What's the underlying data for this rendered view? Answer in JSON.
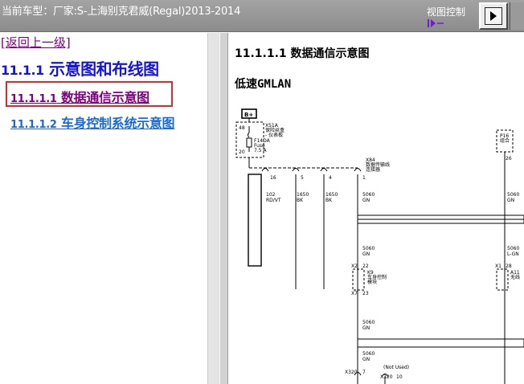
{
  "header": {
    "vehicle_text": "当前车型：厂家:S-上海别克君威(Regal)2013-2014",
    "view_control_label": "视图控制",
    "scroll_icon": "scroll-arrows-icon",
    "view_button_icon": "arrow-right-icon"
  },
  "nav": {
    "back_label": "[返回上一级]",
    "section_number": "11.1.1",
    "section_title": "示意图和布线图",
    "items": [
      {
        "number": "11.1.1.1",
        "label": "数据通信示意图",
        "state": "visited-current"
      },
      {
        "number": "11.1.1.2",
        "label": "车身控制系统示意图",
        "state": "link"
      }
    ],
    "highlight_color": "#e02a2a",
    "link_color": "#1a6ad6",
    "visited_color": "#800080",
    "heading_color": "#1515d6"
  },
  "content": {
    "title": "11.1.1.1 数据通信示意图",
    "subtitle": "低速GMLAN",
    "diagram": {
      "battery": "B+",
      "fuse_block_id": "X51A",
      "fuse_block_name_1": "保险丝盒",
      "fuse_block_name_2": "- 仪表板",
      "fuse_pin_top": "48",
      "fuse_pin_bottom": "20",
      "fuse_name": "F14DA",
      "fuse_word": "Fuse",
      "fuse_rating": "7.5 A",
      "right_connector_id": "P16",
      "right_connector_name": "组合",
      "right_connector_pin": "26",
      "dlc_id": "X84",
      "dlc_name_1": "数据传输线",
      "dlc_name_2": "连接器",
      "dlc_pins": [
        "16",
        "5",
        "4",
        "1"
      ],
      "wires": [
        {
          "circuit": "102",
          "color": "RD/VT"
        },
        {
          "circuit": "1650",
          "color": "BK"
        },
        {
          "circuit": "1650",
          "color": "BK"
        },
        {
          "circuit": "5060",
          "color": "GN"
        }
      ],
      "right_wire_circuit": "5060",
      "right_wire_color": "GN",
      "mid_wire_circuit": "5060",
      "mid_wire_color": "GN",
      "right_mid_circuit": "5060",
      "right_mid_color": "L-GN",
      "bcm_pin_top_conn": "X2",
      "bcm_pin_top": "22",
      "bcm_pin_bottom_conn": "X7",
      "bcm_pin_bottom": "23",
      "bcm_id": "K9",
      "bcm_name_1": "车身控制",
      "bcm_name_2": "模块",
      "right_module_conn": "X1",
      "right_module_pin": "28",
      "right_module_id": "A11",
      "right_module_name": "无线",
      "lower_wire_circuit_1": "5060",
      "lower_wire_color_1": "GN",
      "lower_wire_circuit_2": "5060",
      "lower_wire_color_2": "GN",
      "not_used": "(Not Used)",
      "x320_a_label": "X320",
      "x320_a_pin": "7",
      "x320_b_label": "X320",
      "x320_b_pin": "10"
    }
  }
}
